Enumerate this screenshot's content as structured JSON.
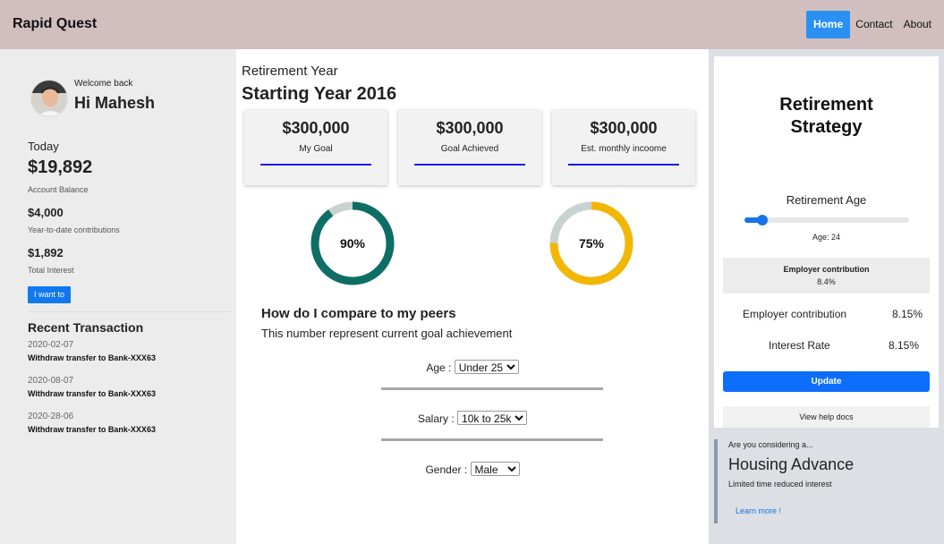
{
  "navbar": {
    "brand": "Rapid Quest",
    "links": [
      {
        "label": "Home",
        "active": true
      },
      {
        "label": "Contact",
        "active": false
      },
      {
        "label": "About",
        "active": false
      }
    ],
    "background": "#d1bfbf",
    "accent": "#2a91f2"
  },
  "profile": {
    "welcome": "Welcome back",
    "greeting": "Hi Mahesh",
    "avatar_icon": "user-avatar"
  },
  "summary": {
    "today_label": "Today",
    "balance": "$19,892",
    "balance_label": "Account Balance",
    "ytd": "$4,000",
    "ytd_label": "Year-to-date contributions",
    "interest": "$1,892",
    "interest_label": "Total Interest",
    "action_label": "I want to"
  },
  "transactions": {
    "title": "Recent Transaction",
    "items": [
      {
        "date": "2020-02-07",
        "desc": "Withdraw transfer to Bank-XXX63"
      },
      {
        "date": "2020-08-07",
        "desc": "Withdraw transfer to Bank-XXX63"
      },
      {
        "date": "2020-28-06",
        "desc": "Withdraw transfer to Bank-XXX63"
      }
    ]
  },
  "main": {
    "subtitle": "Retirement Year",
    "title": "Starting Year 2016",
    "cards": [
      {
        "value": "$300,000",
        "label": "My Goal"
      },
      {
        "value": "$300,000",
        "label": "Goal Achieved"
      },
      {
        "value": "$300,000",
        "label": "Est. monthly incoome"
      }
    ],
    "donuts": [
      {
        "label": "90%",
        "value": 90,
        "color": "#0e6e66",
        "track": "#c8d2d0"
      },
      {
        "label": "75%",
        "value": 75,
        "color": "#f2b705",
        "track": "#c8d2d0"
      }
    ],
    "peers_title": "How do I compare to my peers",
    "peers_sub": "This number represent current goal achievement",
    "filters": [
      {
        "label": "Age :",
        "selected": "Under 25"
      },
      {
        "label": "Salary :",
        "selected": "10k to 25k"
      },
      {
        "label": "Gender :",
        "selected": "Male"
      }
    ]
  },
  "strategy": {
    "title_line1": "Retirement",
    "title_line2": "Strategy",
    "age_label": "Retirement Age",
    "age_readout": "Age: 24",
    "slider_fraction": 0.11,
    "employer_box_title": "Employer contribution",
    "employer_box_value": "8.4%",
    "rows": [
      {
        "label": "Employer contribution",
        "value": "8.15%"
      },
      {
        "label": "Interest Rate",
        "value": "8.15%"
      }
    ],
    "update_label": "Update",
    "help_label": "View help docs"
  },
  "promo": {
    "pre": "Are you considering a...",
    "title": "Housing Advance",
    "sub": "Limited time reduced interest",
    "link": "Learn more !"
  }
}
